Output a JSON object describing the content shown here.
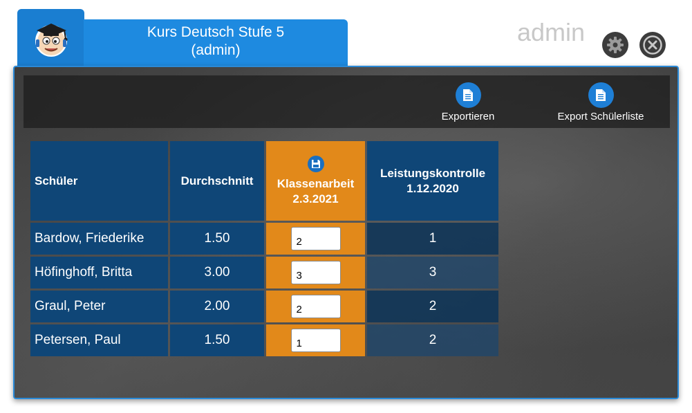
{
  "header": {
    "course_title": "Kurs Deutsch Stufe 5",
    "course_role": "(admin)",
    "user_name": "admin"
  },
  "toolbar": {
    "export_label": "Exportieren",
    "export_list_label": "Export Schülerliste"
  },
  "table": {
    "headers": {
      "student": "Schüler",
      "average": "Durchschnitt",
      "exam_title": "Klassenarbeit",
      "exam_date": "2.3.2021",
      "test_title": "Leistungskontrolle",
      "test_date": "1.12.2020"
    },
    "rows": [
      {
        "name": "Bardow, Friederike",
        "average": "1.50",
        "exam_grade": "2",
        "test_grade": "1"
      },
      {
        "name": "Höfinghoff, Britta",
        "average": "3.00",
        "exam_grade": "3",
        "test_grade": "3"
      },
      {
        "name": "Graul, Peter",
        "average": "2.00",
        "exam_grade": "2",
        "test_grade": "2"
      },
      {
        "name": "Petersen, Paul",
        "average": "1.50",
        "exam_grade": "1",
        "test_grade": "2"
      }
    ]
  },
  "colors": {
    "accent_blue": "#1e8ae0",
    "header_navy": "#0f4677",
    "highlight_orange": "#e2891a"
  },
  "icons": {
    "logo": "teacher-mascot-icon",
    "settings": "gear-icon",
    "close": "close-icon",
    "export": "document-icon",
    "save": "save-icon"
  }
}
